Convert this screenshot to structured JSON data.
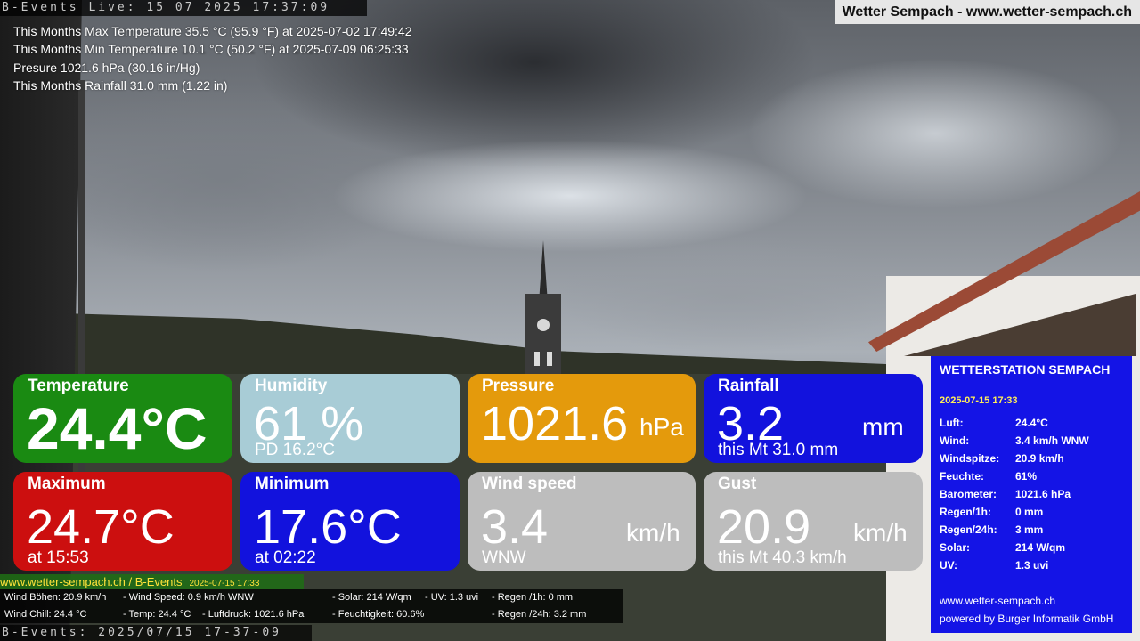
{
  "timestamp_top": "B-Events Live: 15 07 2025 17:37:09",
  "brand": "Wetter Sempach - www.wetter-sempach.ch",
  "stats": [
    "This Months Max Temperature 35.5 °C (95.9 °F) at 2025-07-02 17:49:42",
    "This Months Min Temperature 10.1 °C (50.2 °F) at 2025-07-09 06:25:33",
    "Presure 1021.6 hPa (30.16 in/Hg)",
    "This Months Rainfall 31.0 mm (1.22 in)"
  ],
  "colors": {
    "temperature": "#1a8a12",
    "humidity": "#a8ccd6",
    "pressure": "#e49a0c",
    "rainfall": "#1212dd",
    "maximum": "#cc0f0f",
    "minimum": "#1212dd",
    "wind": "#bdbdbd",
    "panel": "#1414e6"
  },
  "tiles": {
    "temperature": {
      "title": "Temperature",
      "value": "24.4°C"
    },
    "humidity": {
      "title": "Humidity",
      "value": "61 %",
      "sub": "PD 16.2°C"
    },
    "pressure": {
      "title": "Pressure",
      "value": "1021.6",
      "unit": "hPa"
    },
    "rainfall": {
      "title": "Rainfall",
      "value": "3.2",
      "unit": "mm",
      "sub": "this Mt 31.0 mm"
    },
    "maximum": {
      "title": "Maximum",
      "value": "24.7°C",
      "sub": "at 15:53"
    },
    "minimum": {
      "title": "Minimum",
      "value": "17.6°C",
      "sub": "at 02:22"
    },
    "wind_speed": {
      "title": "Wind speed",
      "value": "3.4",
      "unit": "km/h",
      "sub": "WNW"
    },
    "gust": {
      "title": "Gust",
      "value": "20.9",
      "unit": "km/h",
      "sub": "this Mt 40.3 km/h"
    }
  },
  "panel": {
    "title": "WETTERSTATION SEMPACH",
    "date": "2025-07-15 17:33",
    "rows": [
      {
        "key": "Luft:",
        "value": "24.4°C"
      },
      {
        "key": "Wind:",
        "value": "3.4 km/h  WNW"
      },
      {
        "key": "Windspitze:",
        "value": "20.9 km/h"
      },
      {
        "key": "Feuchte:",
        "value": "61%"
      },
      {
        "key": "Barometer:",
        "value": "1021.6 hPa"
      },
      {
        "key": "Regen/1h:",
        "value": "0 mm"
      },
      {
        "key": "Regen/24h:",
        "value": "3 mm"
      },
      {
        "key": "Solar:",
        "value": "214 W/qm"
      },
      {
        "key": "UV:",
        "value": "1.3 uvi"
      }
    ],
    "site": "www.wetter-sempach.ch",
    "powered": "powered by Burger Informatik GmbH"
  },
  "site_bar": {
    "label": "www.wetter-sempach.ch / B-Events",
    "date": "2025-07-15 17:33"
  },
  "info_bar": {
    "row1": [
      "Wind Böhen: 20.9 km/h",
      "- Wind Speed: 0.9 km/h WNW",
      "- Solar: 214 W/qm",
      "- UV: 1.3 uvi",
      "- Regen /1h:   0 mm"
    ],
    "row2": [
      "Wind Chill: 24.4 °C",
      "- Temp: 24.4 °C",
      "- Luftdruck: 1021.6 hPa",
      "- Feuchtigkeit: 60.6%",
      "- Regen /24h: 3.2 mm"
    ]
  },
  "timestamp_bottom": "B-Events: 2025/07/15 17-37-09"
}
